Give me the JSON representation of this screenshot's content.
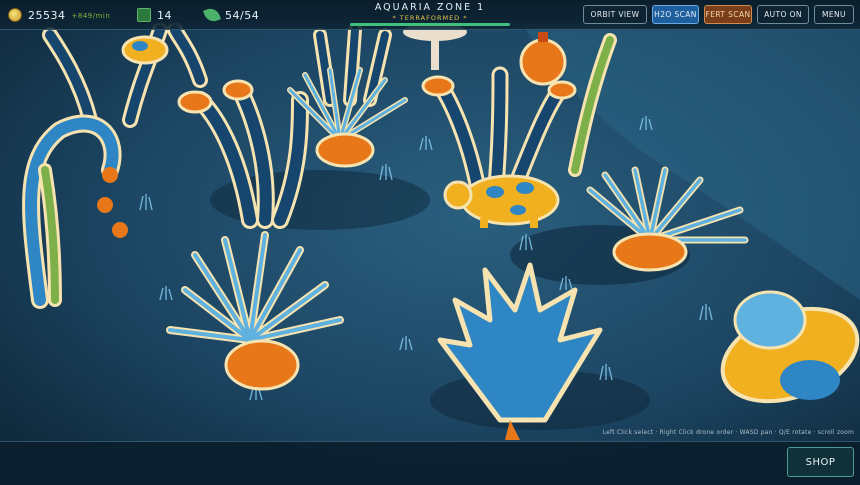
{
  "hud": {
    "credits": "25534",
    "credits_rate": "+849/min",
    "population": "14",
    "plants": "54/54"
  },
  "zone": {
    "name": "AQUARIA  ZONE 1",
    "status": "* TERRAFORMED *",
    "progress": 1.0
  },
  "buttons": {
    "orbit_view": "ORBIT VIEW",
    "h2o_scan": "H2O SCAN",
    "fert_scan": "FERT SCAN",
    "auto_on": "AUTO ON",
    "menu": "MENU",
    "shop": "SHOP"
  },
  "hint": "Left Click select · Right Click drone order · WASD pan · Q/E rotate · scroll zoom",
  "colors": {
    "accent_h2o": "#1f5fa0",
    "accent_fert": "#7a3f1a",
    "progress": "#3fc07d",
    "plant_blue": "#2f86c4",
    "plant_orange": "#e8771a",
    "plant_cream": "#f6e3b0",
    "ground": "#1d4763"
  }
}
